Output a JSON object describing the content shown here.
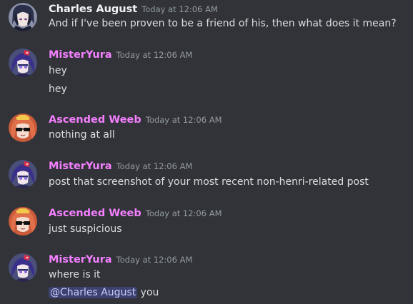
{
  "colors": {
    "background": "#313338",
    "username_pink": "#f47fff",
    "username_white": "#f2f3f5",
    "timestamp": "#949ba4",
    "message_text": "#dbdee1",
    "mention_bg": "#3c4270",
    "mention_text": "#c9cdfb"
  },
  "messages": [
    {
      "author": "Charles August",
      "timestamp": "Today at 12:06 AM",
      "avatar_icon": "charles-avatar-icon",
      "lines": [
        "And if I've been proven to be a friend of his, then what does it mean?"
      ]
    },
    {
      "author": "MisterYura",
      "timestamp": "Today at 12:06 AM",
      "avatar_icon": "misteryura-avatar-icon",
      "lines": [
        "hey",
        "hey"
      ]
    },
    {
      "author": "Ascended Weeb",
      "timestamp": "Today at 12:06 AM",
      "avatar_icon": "ascended-weeb-avatar-icon",
      "lines": [
        "nothing at all"
      ]
    },
    {
      "author": "MisterYura",
      "timestamp": "Today at 12:06 AM",
      "avatar_icon": "misteryura-avatar-icon",
      "lines": [
        "post that screenshot of your most recent non-henri-related post"
      ]
    },
    {
      "author": "Ascended Weeb",
      "timestamp": "Today at 12:06 AM",
      "avatar_icon": "ascended-weeb-avatar-icon",
      "lines": [
        "just suspicious"
      ]
    },
    {
      "author": "MisterYura",
      "timestamp": "Today at 12:06 AM",
      "avatar_icon": "misteryura-avatar-icon",
      "lines": [
        "where is it"
      ],
      "mention": "@Charles August",
      "mention_suffix": " you"
    }
  ]
}
